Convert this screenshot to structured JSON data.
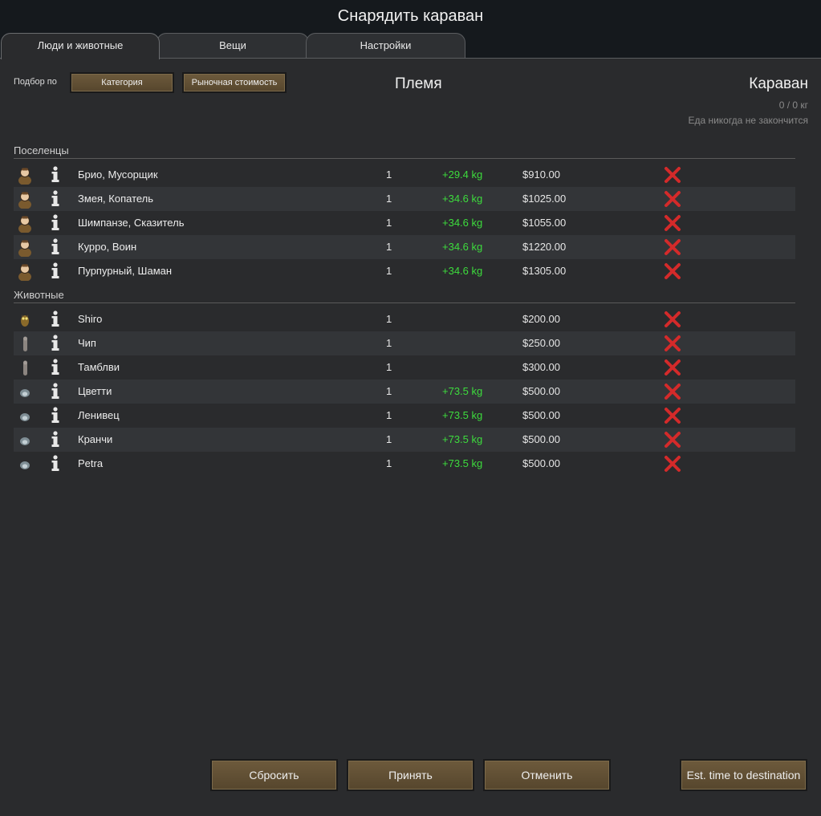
{
  "window": {
    "title": "Снарядить караван"
  },
  "tabs": [
    {
      "label": "Люди и животные",
      "active": true
    },
    {
      "label": "Вещи",
      "active": false
    },
    {
      "label": "Настройки",
      "active": false
    }
  ],
  "sort": {
    "label": "Подбор по",
    "category_button": "Категория",
    "market_value_button": "Рыночная стоимость"
  },
  "tribe": {
    "header": "Племя"
  },
  "caravan": {
    "header": "Караван",
    "mass": "0 / 0 кг",
    "food": "Еда никогда не закончится"
  },
  "sections": {
    "colonists": {
      "label": "Поселенцы",
      "rows": [
        {
          "icon": "colonist-portrait-icon",
          "name": "Брио, Мусорщик",
          "count": "1",
          "mass": "+29.4 kg",
          "price": "$910.00"
        },
        {
          "icon": "colonist-portrait-icon",
          "name": "Змея, Копатель",
          "count": "1",
          "mass": "+34.6 kg",
          "price": "$1025.00"
        },
        {
          "icon": "colonist-portrait-icon",
          "name": "Шимпанзе, Сказитель",
          "count": "1",
          "mass": "+34.6 kg",
          "price": "$1055.00"
        },
        {
          "icon": "colonist-portrait-icon",
          "name": "Курро, Воин",
          "count": "1",
          "mass": "+34.6 kg",
          "price": "$1220.00"
        },
        {
          "icon": "colonist-portrait-icon",
          "name": "Пурпурный, Шаман",
          "count": "1",
          "mass": "+34.6 kg",
          "price": "$1305.00"
        }
      ]
    },
    "animals": {
      "label": "Животные",
      "rows": [
        {
          "icon": "animal-owl-icon",
          "name": "Shiro",
          "count": "1",
          "mass": "",
          "price": "$200.00"
        },
        {
          "icon": "animal-standing-icon",
          "name": "Чип",
          "count": "1",
          "mass": "",
          "price": "$250.00"
        },
        {
          "icon": "animal-standing-icon",
          "name": "Тамблви",
          "count": "1",
          "mass": "",
          "price": "$300.00"
        },
        {
          "icon": "animal-round-icon",
          "name": "Цветти",
          "count": "1",
          "mass": "+73.5 kg",
          "price": "$500.00"
        },
        {
          "icon": "animal-round-icon",
          "name": "Ленивец",
          "count": "1",
          "mass": "+73.5 kg",
          "price": "$500.00"
        },
        {
          "icon": "animal-round-icon",
          "name": "Кранчи",
          "count": "1",
          "mass": "+73.5 kg",
          "price": "$500.00"
        },
        {
          "icon": "animal-round-icon",
          "name": "Petra",
          "count": "1",
          "mass": "+73.5 kg",
          "price": "$500.00"
        }
      ]
    }
  },
  "footer": {
    "reset": "Сбросить",
    "accept": "Принять",
    "cancel": "Отменить",
    "est_time": "Est. time to destination"
  },
  "colors": {
    "positive_mass": "#3ddc3d",
    "remove_x": "#d42a2a",
    "button": "#624f34"
  }
}
